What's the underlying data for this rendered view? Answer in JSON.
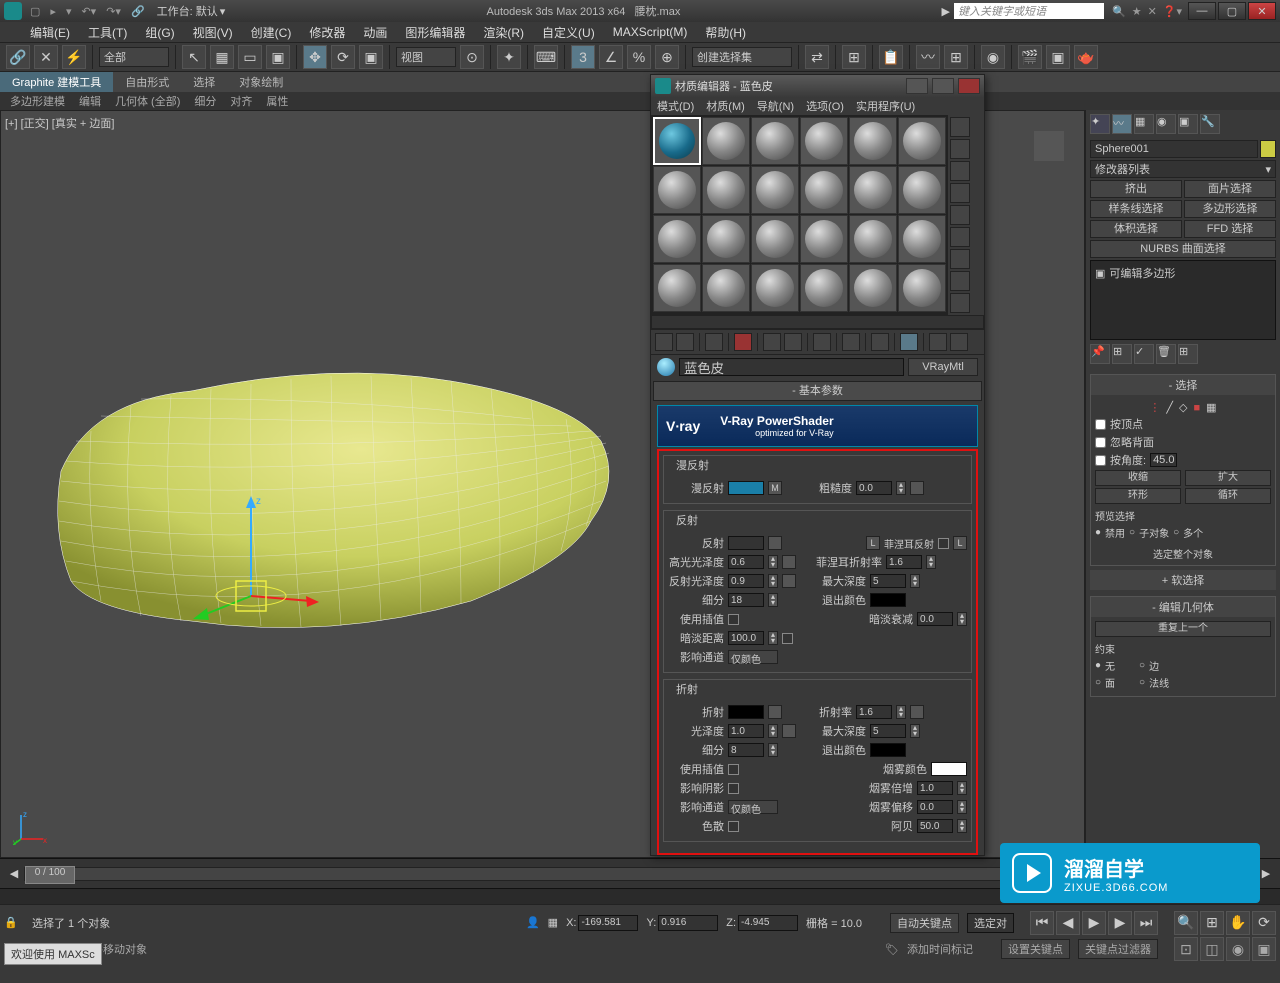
{
  "titlebar": {
    "workspace_label": "工作台: 默认",
    "app": "Autodesk 3ds Max  2013 x64",
    "file": "腰枕.max",
    "search_placeholder": "键入关键字或短语"
  },
  "menubar": [
    "编辑(E)",
    "工具(T)",
    "组(G)",
    "视图(V)",
    "创建(C)",
    "修改器",
    "动画",
    "图形编辑器",
    "渲染(R)",
    "自定义(U)",
    "MAXScript(M)",
    "帮助(H)"
  ],
  "toolbar": {
    "filter_dropdown": "全部",
    "view_dropdown": "视图",
    "selset_dropdown": "创建选择集"
  },
  "ribbon": {
    "tabs": [
      "Graphite 建模工具",
      "自由形式",
      "选择",
      "对象绘制"
    ],
    "sub": [
      "多边形建模",
      "编辑",
      "几何体 (全部)",
      "细分",
      "对齐",
      "属性"
    ]
  },
  "viewport": {
    "label": "[+] [正交] [真实 + 边面]"
  },
  "right": {
    "objname": "Sphere001",
    "modlist": "修改器列表",
    "buttons": [
      "挤出",
      "面片选择",
      "样条线选择",
      "多边形选择",
      "体积选择",
      "FFD 选择",
      "NURBS 曲面选择"
    ],
    "stack_item": "可编辑多边形",
    "sel_hdr": "选择",
    "chk_vertex": "按顶点",
    "chk_ignore": "忽略背面",
    "chk_angle": "按角度:",
    "angle_val": "45.0",
    "btn_shrink": "收缩",
    "btn_grow": "扩大",
    "btn_ring": "环形",
    "btn_loop": "循环",
    "preview_label": "预览选择",
    "rad_disable": "禁用",
    "rad_sub": "子对象",
    "rad_multi": "多个",
    "sel_whole": "选定整个对象",
    "soft_hdr": "软选择",
    "editgeo_hdr": "编辑几何体",
    "repeat": "重复上一个",
    "constraint": "约束",
    "rad_none": "无",
    "rad_edge": "边",
    "rad_face": "面",
    "rad_normal": "法线"
  },
  "material": {
    "title": "材质编辑器 - 蓝色皮",
    "menus": [
      "模式(D)",
      "材质(M)",
      "导航(N)",
      "选项(O)",
      "实用程序(U)"
    ],
    "name": "蓝色皮",
    "type": "VRayMtl",
    "rollout_basic": "基本参数",
    "vray_brand": "V∙ray",
    "vray_title": "V-Ray PowerShader",
    "vray_sub": "optimized for V-Ray",
    "diffuse": {
      "group": "漫反射",
      "label": "漫反射",
      "rough_label": "粗糙度",
      "rough": "0.0"
    },
    "reflect": {
      "group": "反射",
      "label": "反射",
      "hilight_label": "高光光泽度",
      "hilight": "0.6",
      "refl_gloss_label": "反射光泽度",
      "refl_gloss": "0.9",
      "subdiv_label": "细分",
      "subdiv": "18",
      "interp_label": "使用插值",
      "dim_label": "暗淡距离",
      "dim": "100.0",
      "channel_label": "影响通道",
      "channel": "仅颜色",
      "fresnel_label": "菲涅耳反射",
      "fresnel_ior_label": "菲涅耳折射率",
      "fresnel_ior": "1.6",
      "maxdepth_label": "最大深度",
      "maxdepth": "5",
      "exit_label": "退出颜色",
      "dimfall_label": "暗淡衰减",
      "dimfall": "0.0"
    },
    "refract": {
      "group": "折射",
      "label": "折射",
      "gloss_label": "光泽度",
      "gloss": "1.0",
      "subdiv_label": "细分",
      "subdiv": "8",
      "interp_label": "使用插值",
      "shadow_label": "影响阴影",
      "channel_label": "影响通道",
      "channel": "仅颜色",
      "disp_label": "色散",
      "ior_label": "折射率",
      "ior": "1.6",
      "maxdepth_label": "最大深度",
      "maxdepth": "5",
      "exit_label": "退出颜色",
      "fog_label": "烟雾颜色",
      "fogmult_label": "烟雾倍增",
      "fogmult": "1.0",
      "fogbias_label": "烟雾偏移",
      "fogbias": "0.0",
      "abbe_label": "阿贝",
      "abbe": "50.0"
    }
  },
  "timeline": {
    "range": "0 / 100"
  },
  "status": {
    "selected": "选择了 1 个对象",
    "x": "-169.581",
    "y": "0.916",
    "z": "-4.945",
    "grid": "栅格 = 10.0",
    "autokey": "自动关键点",
    "selset": "选定对",
    "hint": "单击并拖动以选择并移动对象",
    "addtime": "添加时间标记",
    "setkey": "设置关键点",
    "keyfilter": "关键点过滤器"
  },
  "welcome": {
    "t1": "欢迎使用",
    "t2": "MAXSc"
  },
  "watermark": {
    "title": "溜溜自学",
    "url": "ZIXUE.3D66.COM"
  }
}
